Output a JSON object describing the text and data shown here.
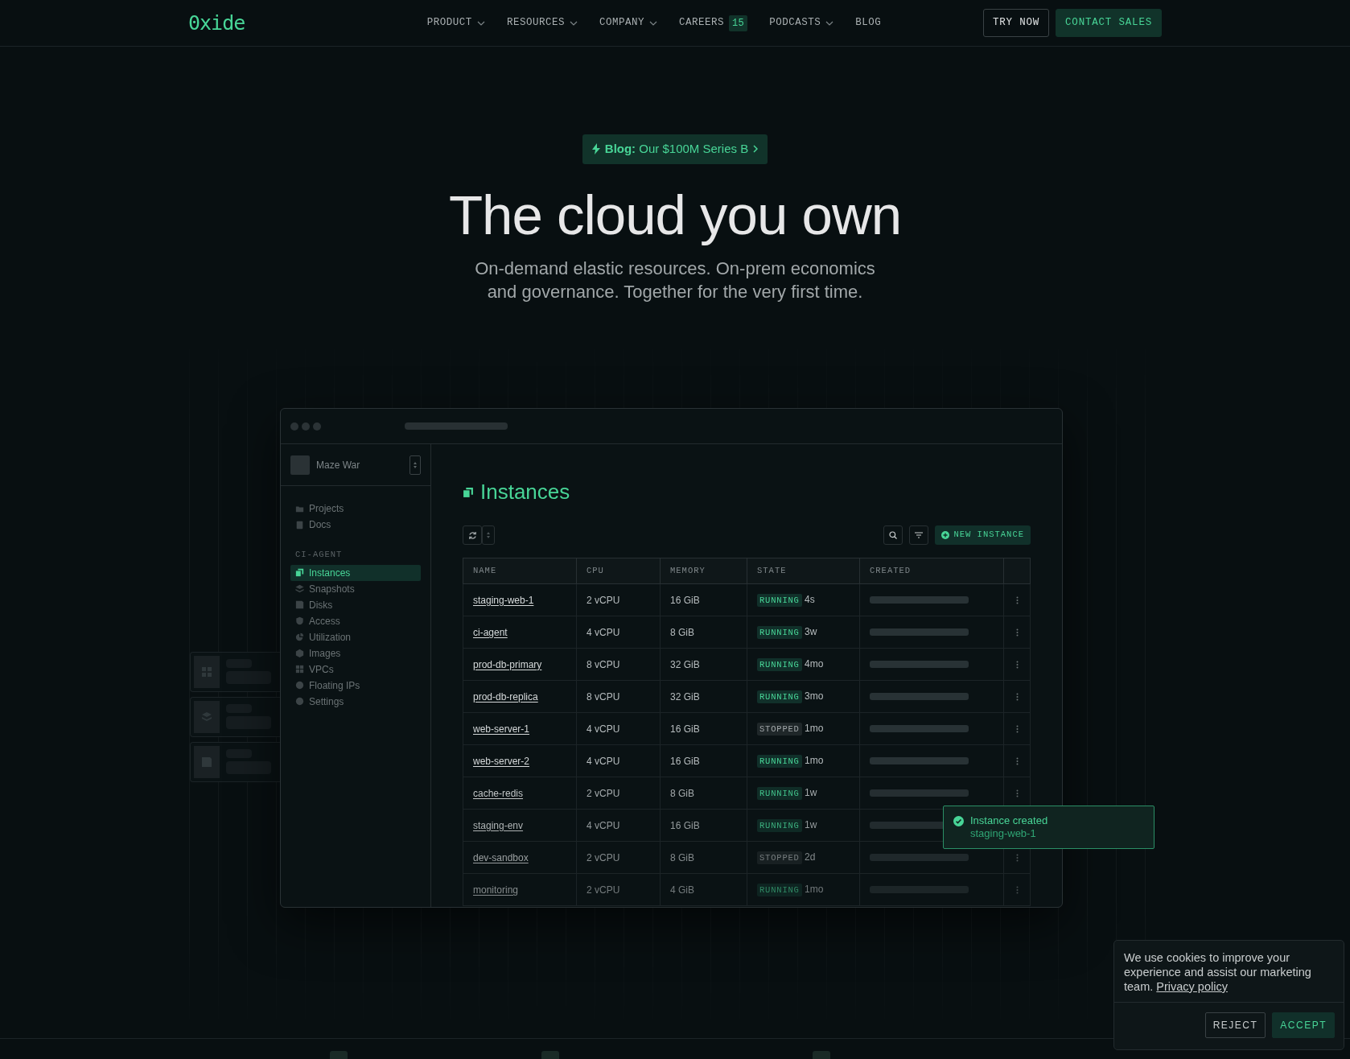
{
  "nav": {
    "logo": "0xide",
    "links": [
      {
        "label": "PRODUCT",
        "dropdown": true
      },
      {
        "label": "RESOURCES",
        "dropdown": true
      },
      {
        "label": "COMPANY",
        "dropdown": true
      },
      {
        "label": "CAREERS",
        "dropdown": false,
        "count": "15"
      },
      {
        "label": "PODCASTS",
        "dropdown": true
      },
      {
        "label": "BLOG",
        "dropdown": false
      }
    ],
    "buttons": [
      {
        "label": "TRY NOW",
        "kind": "outline"
      },
      {
        "label": "CONTACT SALES",
        "kind": "primary"
      }
    ]
  },
  "hero": {
    "badge": {
      "prefix": "Blog:",
      "text": "Our $100M Series B"
    },
    "title": "The cloud you own",
    "subtitle": "On-demand elastic resources. On-prem economics and governance. Together for the very first time."
  },
  "app": {
    "project": "Maze War",
    "nav": [
      {
        "label": "Projects"
      },
      {
        "label": "Docs"
      }
    ],
    "section": "CI-AGENT",
    "items": [
      {
        "label": "Instances",
        "selected": true
      },
      {
        "label": "Snapshots",
        "selected": false
      },
      {
        "label": "Disks",
        "selected": false
      },
      {
        "label": "Access",
        "selected": false
      },
      {
        "label": "Utilization",
        "selected": false
      },
      {
        "label": "Images",
        "selected": false
      },
      {
        "label": "VPCs",
        "selected": false
      },
      {
        "label": "Floating IPs",
        "selected": false
      },
      {
        "label": "Settings",
        "selected": false
      }
    ],
    "page_title": "Instances",
    "new_button": "NEW INSTANCE",
    "table": {
      "columns": [
        "NAME",
        "CPU",
        "MEMORY",
        "STATE",
        "CREATED"
      ],
      "rows": [
        {
          "name": "staging-web-1",
          "cpu": "2 vCPU",
          "memory": "16 GiB",
          "state": "RUNNING",
          "kind": "running",
          "age": "4s"
        },
        {
          "name": "ci-agent",
          "cpu": "4 vCPU",
          "memory": "8 GiB",
          "state": "RUNNING",
          "kind": "running",
          "age": "3w"
        },
        {
          "name": "prod-db-primary",
          "cpu": "8 vCPU",
          "memory": "32 GiB",
          "state": "RUNNING",
          "kind": "running",
          "age": "4mo"
        },
        {
          "name": "prod-db-replica",
          "cpu": "8 vCPU",
          "memory": "32 GiB",
          "state": "RUNNING",
          "kind": "running",
          "age": "3mo"
        },
        {
          "name": "web-server-1",
          "cpu": "4 vCPU",
          "memory": "16 GiB",
          "state": "STOPPED",
          "kind": "stopped",
          "age": "1mo"
        },
        {
          "name": "web-server-2",
          "cpu": "4 vCPU",
          "memory": "16 GiB",
          "state": "RUNNING",
          "kind": "running",
          "age": "1mo"
        },
        {
          "name": "cache-redis",
          "cpu": "2 vCPU",
          "memory": "8 GiB",
          "state": "RUNNING",
          "kind": "running",
          "age": "1w"
        },
        {
          "name": "staging-env",
          "cpu": "4 vCPU",
          "memory": "16 GiB",
          "state": "RUNNING",
          "kind": "running",
          "age": "1w"
        },
        {
          "name": "dev-sandbox",
          "cpu": "2 vCPU",
          "memory": "8 GiB",
          "state": "STOPPED",
          "kind": "stopped",
          "age": "2d"
        },
        {
          "name": "monitoring",
          "cpu": "2 vCPU",
          "memory": "4 GiB",
          "state": "RUNNING",
          "kind": "running",
          "age": "1mo"
        }
      ]
    }
  },
  "toast": {
    "title": "Instance created",
    "detail": "staging-web-1"
  },
  "cookie": {
    "text": "We use cookies to improve your experience and assist our marketing team.",
    "link": "Privacy policy",
    "buttons": [
      {
        "label": "REJECT",
        "kind": "outline"
      },
      {
        "label": "ACCEPT",
        "kind": "primary"
      }
    ]
  }
}
